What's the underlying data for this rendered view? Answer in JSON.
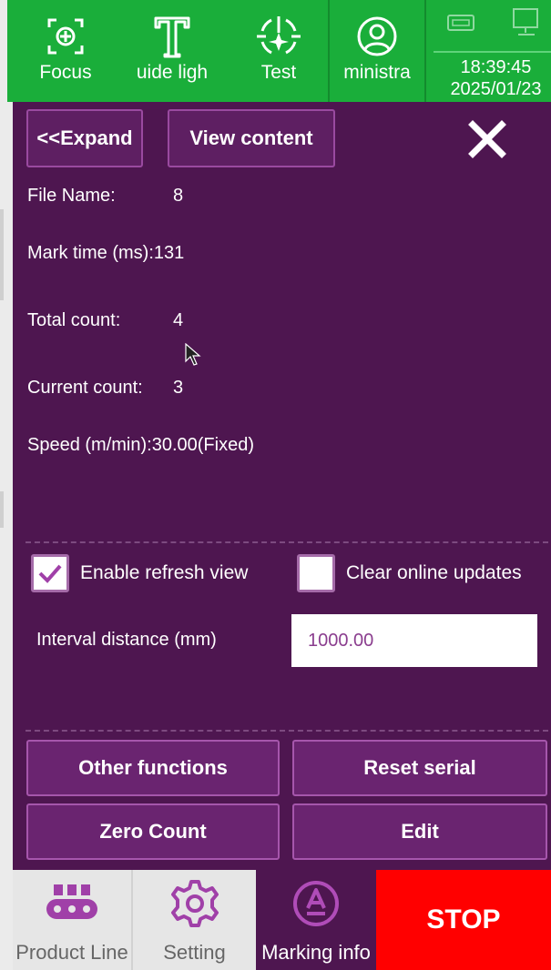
{
  "toolbar": {
    "focus_label": "Focus",
    "guide_label": "uide ligh",
    "test_label": "Test",
    "admin_label": "ministra",
    "time": "18:39:45",
    "date": "2025/01/23"
  },
  "panel": {
    "expand_label": "<<Expand",
    "view_content_label": "View content",
    "info": {
      "file_name_label": "File Name:",
      "file_name_value": "8",
      "mark_time_label": "Mark time (ms):",
      "mark_time_value": "131",
      "total_count_label": "Total count:",
      "total_count_value": "4",
      "current_count_label": "Current count:",
      "current_count_value": "3",
      "speed_label": "Speed (m/min):",
      "speed_value": "30.00(Fixed)"
    },
    "enable_refresh_label": "Enable refresh view",
    "enable_refresh_checked": true,
    "clear_updates_label": "Clear online updates",
    "clear_updates_checked": false,
    "interval_label": "Interval distance (mm)",
    "interval_value": "1000.00",
    "buttons": {
      "other_functions": "Other functions",
      "reset_serial": "Reset serial",
      "zero_count": "Zero Count",
      "edit": "Edit"
    }
  },
  "bottom_nav": {
    "product_line": "Product Line",
    "setting": "Setting",
    "marking_info": "Marking info",
    "stop": "STOP"
  },
  "colors": {
    "toolbar_green": "#1aae3a",
    "panel_purple": "#4e1650",
    "accent_purple": "#a040a8",
    "stop_red": "#ff0000"
  },
  "icons": [
    "focus-icon",
    "guide-light-icon",
    "test-icon",
    "user-icon",
    "usb-icon",
    "monitor-icon",
    "close-icon",
    "check-icon",
    "conveyor-icon",
    "gear-icon",
    "marking-icon"
  ]
}
